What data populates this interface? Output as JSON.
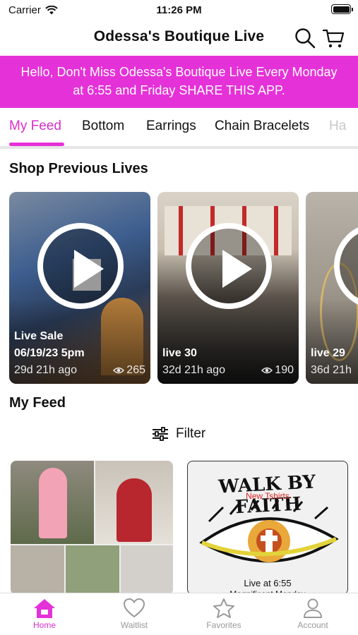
{
  "status_bar": {
    "carrier": "Carrier",
    "time": "11:26 PM"
  },
  "header": {
    "title": "Odessa's Boutique Live"
  },
  "banner": {
    "line1": "Hello, Don't Miss Odessa's Boutique Live Every Monday",
    "line2": "at 6:55 and Friday  SHARE THIS APP."
  },
  "tabs": [
    {
      "label": "My Feed"
    },
    {
      "label": "Bottom"
    },
    {
      "label": "Earrings"
    },
    {
      "label": "Chain Bracelets"
    },
    {
      "label": "Ha"
    }
  ],
  "sections": {
    "previous_lives": "Shop Previous Lives",
    "my_feed": "My Feed"
  },
  "lives": [
    {
      "name": "Live Sale",
      "date": "06/19/23 5pm",
      "ago": "29d 21h ago",
      "views": "265"
    },
    {
      "name": "live 30",
      "ago": "32d 21h ago",
      "views": "190"
    },
    {
      "name": "live 29",
      "ago": "36d 21h"
    }
  ],
  "filter": {
    "label": "Filter"
  },
  "feed": [
    {
      "image": "collage-photo"
    },
    {
      "poster_title": "WALK BY FAITH",
      "poster_subtitle": "New Tshirts",
      "poster_caption": "Live at 6:55",
      "poster_caption2": "Magnificent Monday"
    }
  ],
  "bottom_nav": [
    {
      "label": "Home",
      "icon": "home-icon"
    },
    {
      "label": "Waitlist",
      "icon": "heart-icon"
    },
    {
      "label": "Favorites",
      "icon": "star-icon"
    },
    {
      "label": "Account",
      "icon": "person-icon"
    }
  ],
  "colors": {
    "accent": "#e531d8",
    "accent_text": "#d82fc9"
  }
}
